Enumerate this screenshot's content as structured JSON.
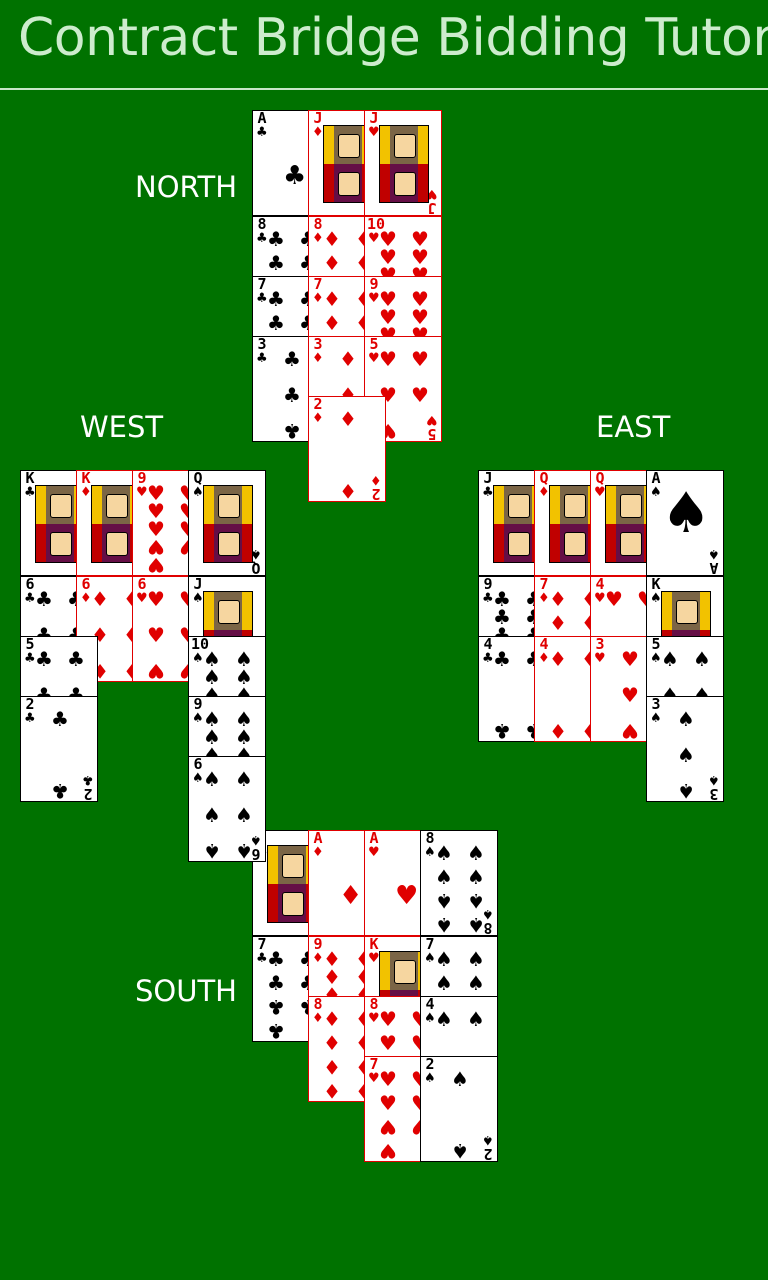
{
  "app": {
    "title": "Contract Bridge Bidding Tutor"
  },
  "seats": {
    "north": "NORTH",
    "west": "WEST",
    "east": "EAST",
    "south": "SOUTH"
  },
  "hands": {
    "north": [
      [
        "A",
        "♣",
        "black"
      ],
      [
        "J",
        "♦",
        "red"
      ],
      [
        "J",
        "♥",
        "red"
      ],
      [
        "8",
        "♣",
        "black"
      ],
      [
        "8",
        "♦",
        "red"
      ],
      [
        "10",
        "♥",
        "red"
      ],
      [
        "7",
        "♣",
        "black"
      ],
      [
        "7",
        "♦",
        "red"
      ],
      [
        "9",
        "♥",
        "red"
      ],
      [
        "3",
        "♣",
        "black"
      ],
      [
        "3",
        "♦",
        "red"
      ],
      [
        "5",
        "♥",
        "red"
      ],
      [
        "2",
        "♦",
        "red"
      ]
    ],
    "west": [
      [
        "K",
        "♣",
        "black"
      ],
      [
        "K",
        "♦",
        "red"
      ],
      [
        "9",
        "♥",
        "red"
      ],
      [
        "Q",
        "♠",
        "black"
      ],
      [
        "6",
        "♣",
        "black"
      ],
      [
        "6",
        "♦",
        "red"
      ],
      [
        "6",
        "♥",
        "red"
      ],
      [
        "J",
        "♠",
        "black"
      ],
      [
        "5",
        "♣",
        "black"
      ],
      [
        "10",
        "♠",
        "black"
      ],
      [
        "2",
        "♣",
        "black"
      ],
      [
        "9",
        "♠",
        "black"
      ],
      [
        "6",
        "♠",
        "black"
      ]
    ],
    "east": [
      [
        "J",
        "♣",
        "black"
      ],
      [
        "Q",
        "♦",
        "red"
      ],
      [
        "Q",
        "♥",
        "red"
      ],
      [
        "A",
        "♠",
        "black"
      ],
      [
        "9",
        "♣",
        "black"
      ],
      [
        "7",
        "♦",
        "red"
      ],
      [
        "4",
        "♥",
        "red"
      ],
      [
        "K",
        "♠",
        "black"
      ],
      [
        "4",
        "♣",
        "black"
      ],
      [
        "4",
        "♦",
        "red"
      ],
      [
        "3",
        "♥",
        "red"
      ],
      [
        "5",
        "♠",
        "black"
      ],
      [
        "3",
        "♠",
        "black"
      ]
    ],
    "south": [
      [
        "Q",
        "♣",
        "black"
      ],
      [
        "A",
        "♦",
        "red"
      ],
      [
        "A",
        "♥",
        "red"
      ],
      [
        "8",
        "♠",
        "black"
      ],
      [
        "7",
        "♣",
        "black"
      ],
      [
        "9",
        "♦",
        "red"
      ],
      [
        "K",
        "♥",
        "red"
      ],
      [
        "7",
        "♠",
        "black"
      ],
      [
        "8",
        "♦",
        "red"
      ],
      [
        "8",
        "♥",
        "red"
      ],
      [
        "4",
        "♠",
        "black"
      ],
      [
        "7",
        "♥",
        "red"
      ],
      [
        "2",
        "♠",
        "black"
      ]
    ]
  },
  "colors": {
    "felt": "#007200",
    "red_suit": "#e00000",
    "title_text": "#cdeccd"
  }
}
